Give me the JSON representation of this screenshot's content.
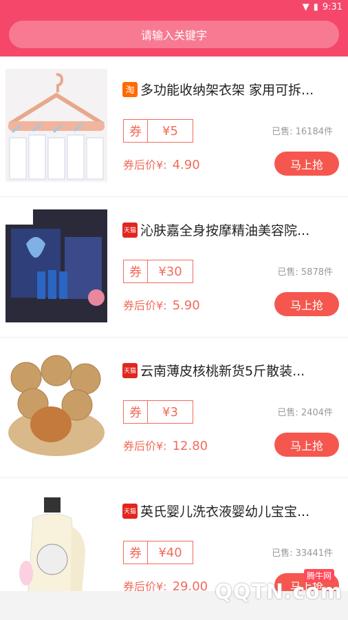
{
  "status_bar": {
    "time": "9:31",
    "wifi_icon": "wifi-icon",
    "battery_icon": "battery-icon"
  },
  "search": {
    "placeholder": "请输入关键字"
  },
  "products": [
    {
      "store": "淘",
      "title": "多功能收纳架衣架 家用可拆...",
      "coupon_label": "券",
      "coupon": "¥5",
      "sold": "已售: 16184件",
      "price_label": "券后价¥:",
      "price": "4.90",
      "button": "马上抢"
    },
    {
      "store": "天猫",
      "title": "沁肤嘉全身按摩精油美容院...",
      "coupon_label": "券",
      "coupon": "¥30",
      "sold": "已售: 5878件",
      "price_label": "券后价¥:",
      "price": "5.90",
      "button": "马上抢"
    },
    {
      "store": "天猫",
      "title": "云南薄皮核桃新货5斤散装...",
      "coupon_label": "券",
      "coupon": "¥3",
      "sold": "已售: 2404件",
      "price_label": "券后价¥:",
      "price": "12.80",
      "button": "马上抢"
    },
    {
      "store": "天猫",
      "title": "英氏婴儿洗衣液婴幼儿宝宝...",
      "coupon_label": "券",
      "coupon": "¥40",
      "sold": "已售: 33441件",
      "price_label": "券后价¥:",
      "price": "29.00",
      "button": "马上抢"
    }
  ],
  "watermark": {
    "site": "QQTN.com",
    "label": "腾牛网"
  }
}
